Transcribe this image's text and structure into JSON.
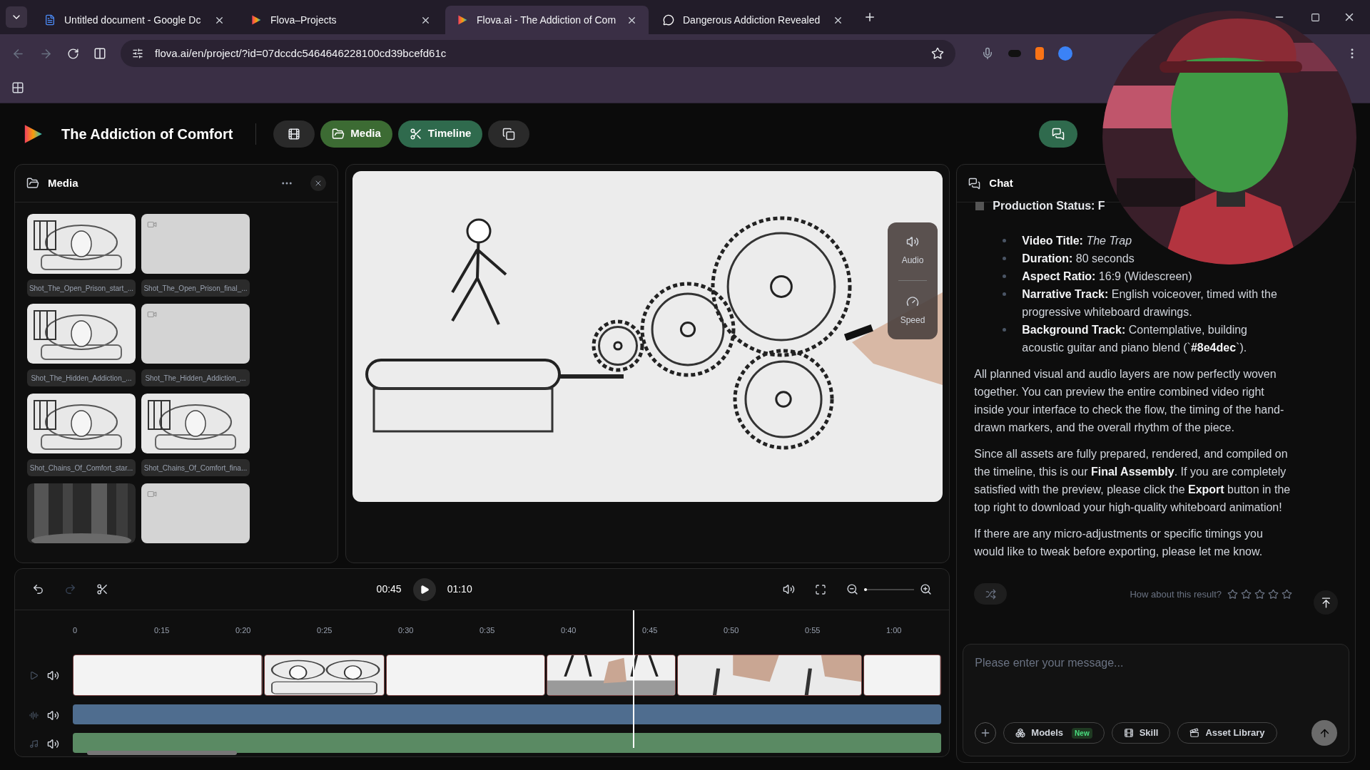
{
  "browser": {
    "tabs": [
      {
        "title": "Untitled document - Google Dc",
        "kind": "doc",
        "selected": false
      },
      {
        "title": "Flova–Projects",
        "kind": "flova",
        "selected": false
      },
      {
        "title": "Flova.ai - The Addiction of Com",
        "kind": "flova",
        "selected": true
      },
      {
        "title": "Dangerous Addiction Revealed",
        "kind": "chat",
        "selected": false
      }
    ],
    "address": "flova.ai/en/project/?id=07dccdc5464646228100cd39bcefd61c"
  },
  "app": {
    "title": "The Addiction of Comfort",
    "toolbar": [
      {
        "kind": "film",
        "selected": false
      },
      {
        "kind": "media",
        "label": "Media",
        "selected": true
      },
      {
        "kind": "timeline",
        "label": "Timeline",
        "selected": true
      },
      {
        "kind": "copy",
        "selected": false
      }
    ]
  },
  "media": {
    "title": "Media",
    "items": [
      {
        "kind": "picture",
        "label": "Shot_The_Open_Prison_start_..."
      },
      {
        "kind": "placeholder",
        "label": "Shot_The_Open_Prison_final_..."
      },
      {
        "kind": "picture",
        "label": "Shot_The_Hidden_Addiction_..."
      },
      {
        "kind": "placeholder",
        "label": "Shot_The_Hidden_Addiction_..."
      },
      {
        "kind": "picture",
        "label": "Shot_Chains_Of_Comfort_star..."
      },
      {
        "kind": "picture",
        "label": "Shot_Chains_Of_Comfort_fina..."
      },
      {
        "kind": "picture"
      },
      {
        "kind": "placeholder"
      }
    ]
  },
  "preview": {
    "controls": [
      {
        "kind": "audio",
        "label": "Audio"
      },
      {
        "kind": "speed",
        "label": "Speed"
      }
    ]
  },
  "chat": {
    "title": "Chat",
    "status": "Production Status: F",
    "bullets": [
      "**Video Title:** *The Trap*",
      "**Duration:** 80 seconds",
      "**Aspect Ratio:** 16:9 (Widescreen)",
      "**Narrative Track:** English voiceover, timed with the progressive whiteboard drawings.",
      "**Background Track:** Contemplative, building acoustic guitar and piano blend (`**#8e4dec**`)."
    ],
    "paragraphs": [
      "All planned visual and audio layers are now perfectly woven together. You can preview the entire combined video right inside your interface to check the flow, the timing of the hand-drawn markers, and the overall rhythm of the piece.",
      "Since all assets are fully prepared, rendered, and compiled on the timeline, this is our **Final Assembly**. If you are completely satisfied with the preview, please click the **Export** button in the top right to download your high-quality whiteboard animation!",
      "If there are any micro-adjustments or specific timings you would like to tweak before exporting, please let me know."
    ],
    "rating_prompt": "How about this result?",
    "stars": 0,
    "input_placeholder": "Please enter your message...",
    "tools": [
      {
        "kind": "models",
        "label": "Models",
        "badge": "New"
      },
      {
        "kind": "skill",
        "label": "Skill"
      },
      {
        "kind": "library",
        "label": "Asset Library"
      }
    ]
  },
  "timeline": {
    "current": "00:45",
    "total": "01:10",
    "zoom": {
      "level": 0.05
    },
    "playhead": {
      "level": 0.645
    },
    "ticks": [
      "0",
      "0:15",
      "0:20",
      "0:25",
      "0:30",
      "0:35",
      "0:40",
      "0:45",
      "0:50",
      "0:55",
      "1:00"
    ],
    "clips": [
      {
        "kind": "blank"
      },
      {
        "kind": "heads"
      },
      {
        "kind": "blank"
      },
      {
        "kind": "walker"
      },
      {
        "kind": "hand"
      },
      {
        "kind": "blank"
      }
    ],
    "tracks": [
      {
        "kind": "video"
      },
      {
        "kind": "voice",
        "color": "#4f6d8f"
      },
      {
        "kind": "music",
        "color": "#5a8a63"
      }
    ]
  }
}
